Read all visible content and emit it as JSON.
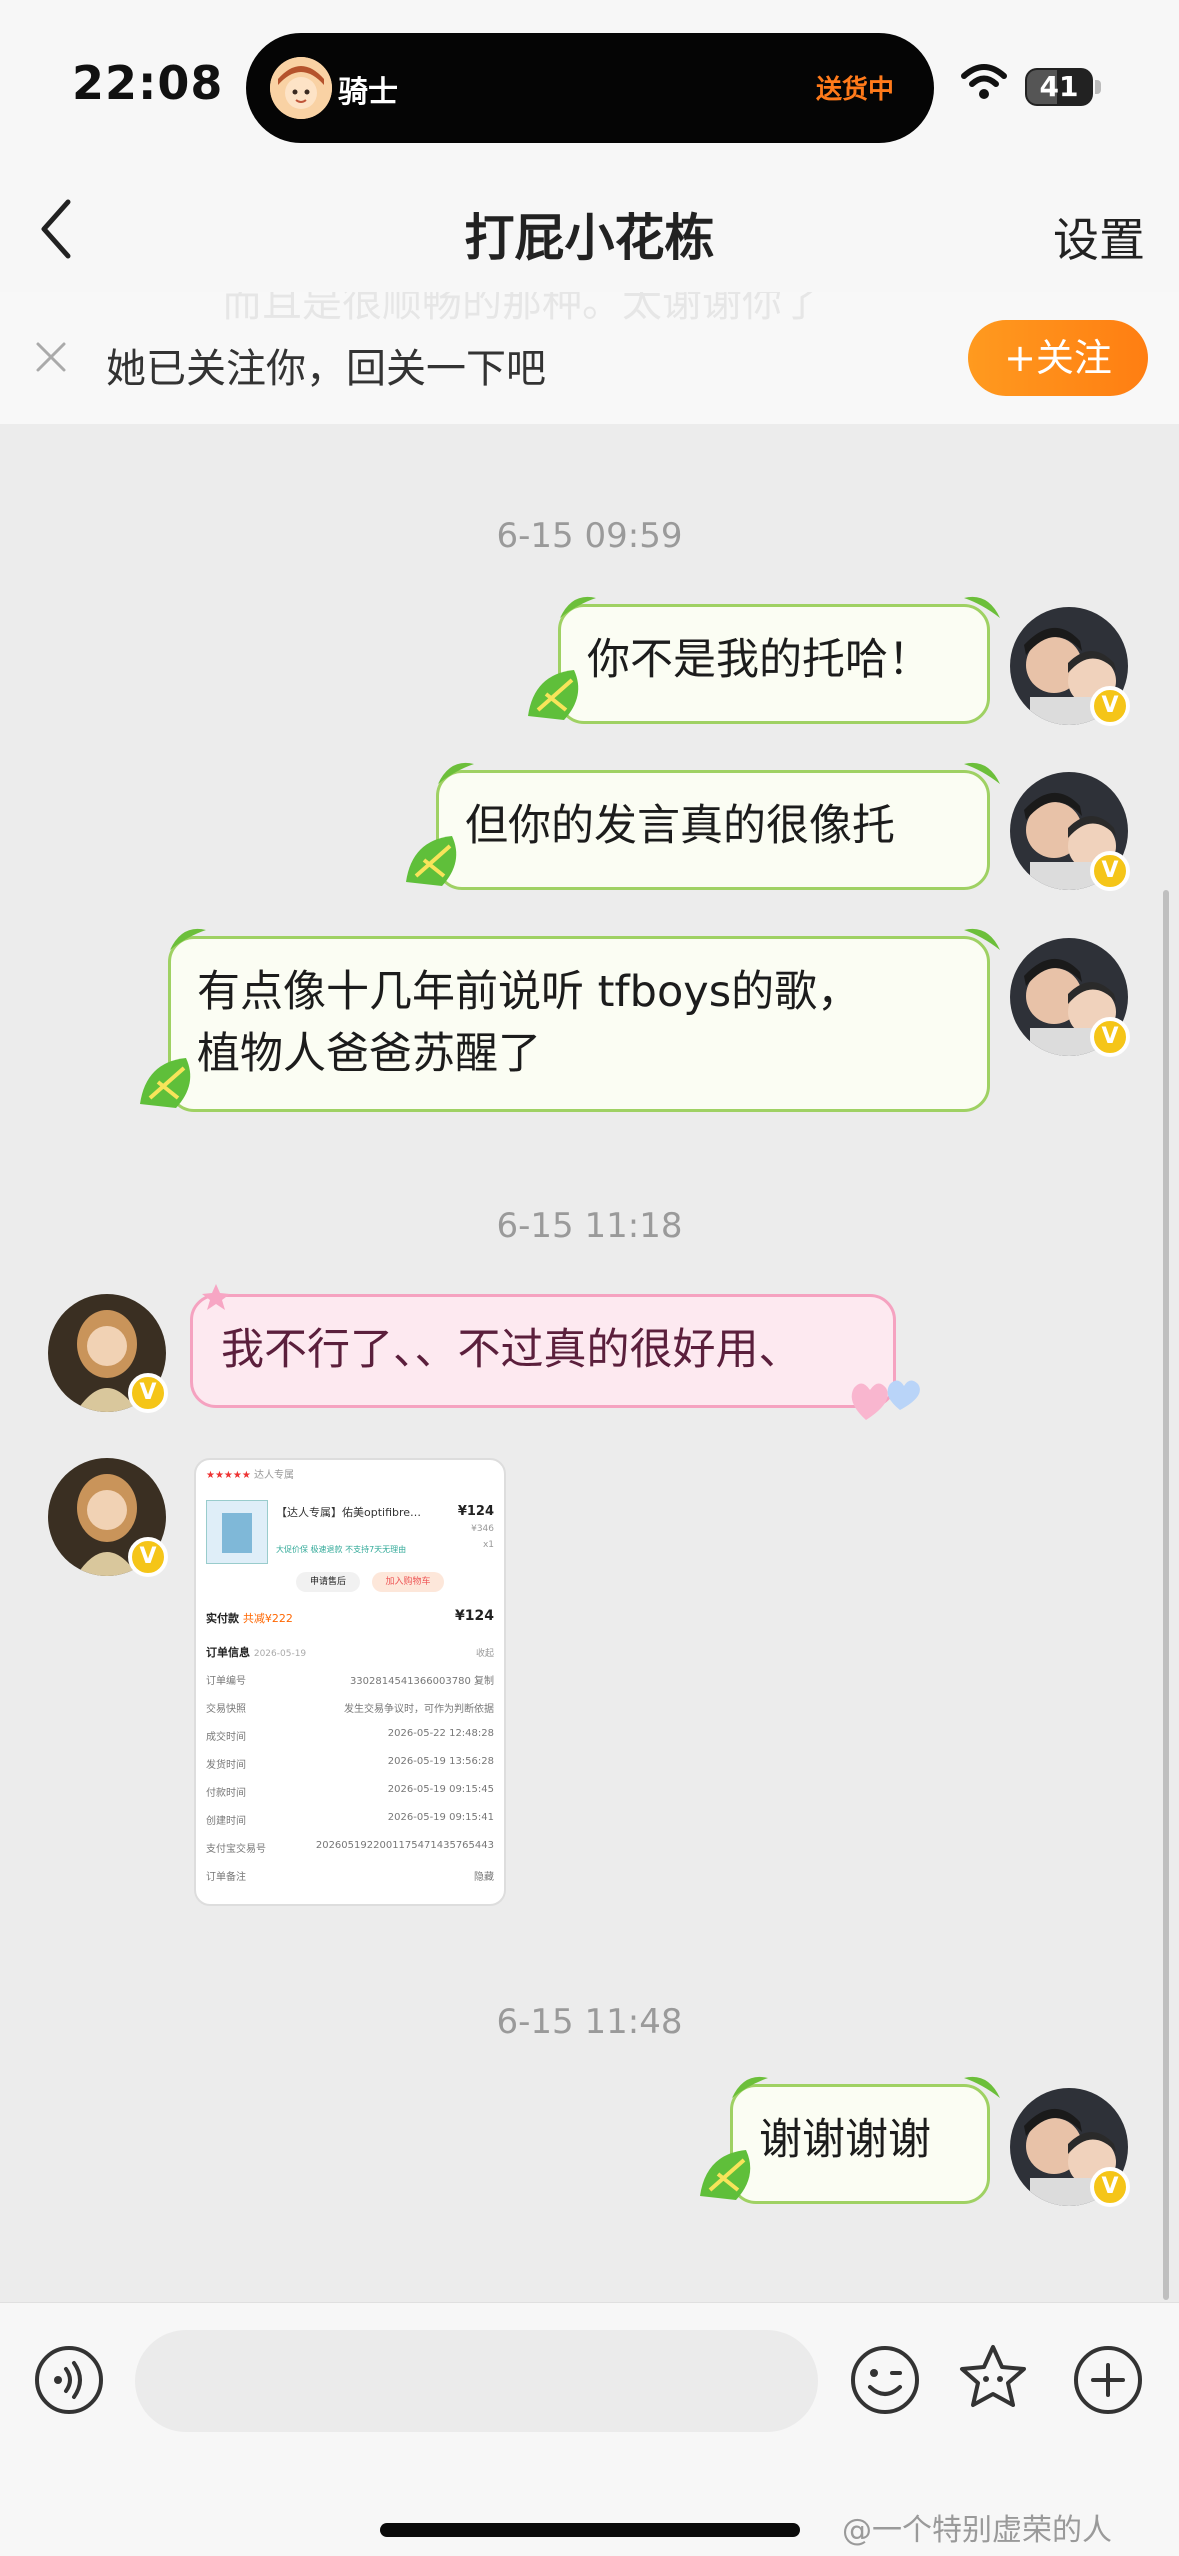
{
  "status_bar": {
    "time": "22:08",
    "island_name": "骑士",
    "island_status": "送货中",
    "battery": "41"
  },
  "header": {
    "title": "打屁小花栋",
    "settings_label": "设置"
  },
  "follow_banner": {
    "text": "她已关注你，回关一下吧",
    "button_label": "+关注",
    "scrolled_text": "而且是很顺畅的那种。太谢谢你了"
  },
  "messages": {
    "ts1": "6-15 09:59",
    "m1": "你不是我的托哈！",
    "m2": "但你的发言真的很像托",
    "m3_line1": "有点像十几年前说听 tfboys的歌，",
    "m3_line2": "植物人爸爸苏醒了",
    "ts2": "6-15 11:18",
    "m4": "我不行了、、不过真的很好用、",
    "ts3": "6-15 11:48",
    "m5": "谢谢谢谢"
  },
  "order_image": {
    "shop_tag": "达人专属",
    "product": "【达人专属】佑美optifibre…",
    "price": "¥124",
    "orig_price": "¥346",
    "qty": "x1",
    "promo": "大促价保  极速退款  不支持7天无理由",
    "btn_refund": "申请售后",
    "btn_cart": "加入购物车",
    "paid_label": "实付款",
    "paid_note": "共减¥222",
    "paid_value": "¥124",
    "info_title": "订单信息",
    "info_date": "2026-05-19",
    "info_toggle": "收起",
    "rows": [
      {
        "k": "订单编号",
        "v": "3302814541366003780  复制"
      },
      {
        "k": "交易快照",
        "v": "发生交易争议时，可作为判断依据"
      },
      {
        "k": "成交时间",
        "v": "2026-05-22 12:48:28"
      },
      {
        "k": "发货时间",
        "v": "2026-05-19 13:56:28"
      },
      {
        "k": "付款时间",
        "v": "2026-05-19 09:15:45"
      },
      {
        "k": "创建时间",
        "v": "2026-05-19 09:15:41"
      },
      {
        "k": "支付宝交易号",
        "v": "2026051922001175471435765443"
      },
      {
        "k": "订单备注",
        "v": "隐藏"
      }
    ]
  },
  "bottom_bar": {
    "placeholder": ""
  },
  "watermark": "@一个特别虚荣的人"
}
